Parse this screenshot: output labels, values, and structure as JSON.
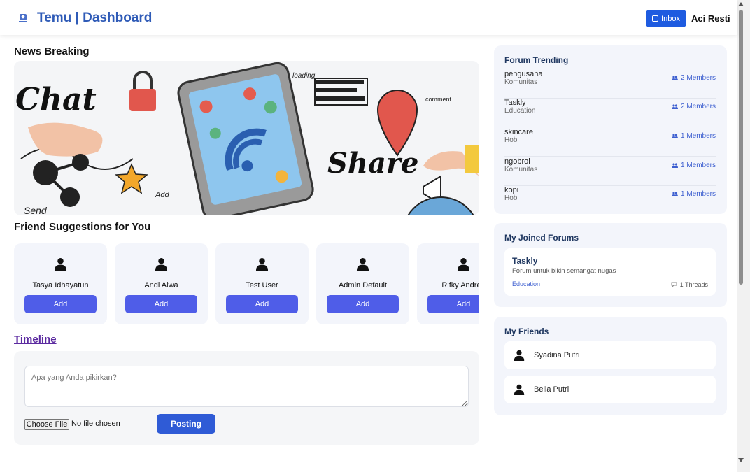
{
  "header": {
    "brand": "Temu | Dashboard",
    "logo_icon": "app-logo-icon",
    "inbox_label": "Inbox",
    "inbox_icon": "inbox-icon",
    "user_name": "Aci Resti",
    "accent": "#2f5bb7"
  },
  "news": {
    "title": "News Breaking",
    "banner_words": [
      "Chat",
      "Share",
      "loading",
      "comment",
      "Add",
      "Send"
    ]
  },
  "suggestions": {
    "title": "Friend Suggestions for You",
    "add_label": "Add",
    "people": [
      {
        "name": "Tasya Idhayatun"
      },
      {
        "name": "Andi Alwa"
      },
      {
        "name": "Test User"
      },
      {
        "name": "Admin Default"
      },
      {
        "name": "Rifky Andrea"
      }
    ]
  },
  "timeline": {
    "title": "Timeline",
    "placeholder": "Apa yang Anda pikirkan?",
    "file_button": "Choose File",
    "file_status": "No file chosen",
    "post_button": "Posting"
  },
  "forum_trending": {
    "title": "Forum Trending",
    "items": [
      {
        "name": "pengusaha",
        "category": "Komunitas",
        "members": "2 Members"
      },
      {
        "name": "Taskly",
        "category": "Education",
        "members": "2 Members"
      },
      {
        "name": "skincare",
        "category": "Hobi",
        "members": "1 Members"
      },
      {
        "name": "ngobrol",
        "category": "Komunitas",
        "members": "1 Members"
      },
      {
        "name": "kopi",
        "category": "Hobi",
        "members": "1 Members"
      }
    ]
  },
  "joined_forums": {
    "title": "My Joined Forums",
    "items": [
      {
        "name": "Taskly",
        "description": "Forum untuk bikin semangat nugas",
        "category": "Education",
        "threads": "1 Threads"
      }
    ]
  },
  "friends": {
    "title": "My Friends",
    "items": [
      {
        "name": "Syadina Putri"
      },
      {
        "name": "Bella Putri"
      }
    ]
  }
}
